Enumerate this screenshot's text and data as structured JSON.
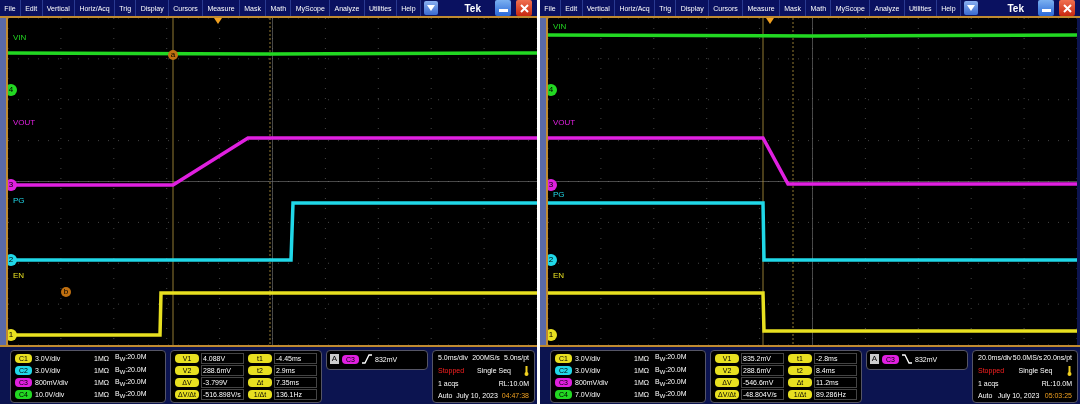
{
  "scopes": [
    {
      "menu": [
        "File",
        "Edit",
        "Vertical",
        "Horiz/Acq",
        "Trig",
        "Display",
        "Cursors",
        "Measure",
        "Mask",
        "Math",
        "MyScope",
        "Analyze",
        "Utilities",
        "Help"
      ],
      "brand": "Tek",
      "traces": [
        {
          "label": "VIN",
          "marker": "4",
          "color": "#22d822"
        },
        {
          "label": "VOUT",
          "marker": "3",
          "color": "#e020e0"
        },
        {
          "label": "PG",
          "marker": "2",
          "color": "#20d8e8"
        },
        {
          "label": "EN",
          "marker": "1",
          "color": "#e8e020"
        }
      ],
      "cursor_marks": [
        "a",
        "b"
      ],
      "channels": [
        {
          "chip": "C1",
          "scale": "3.0V/div",
          "impedance": "1MΩ",
          "bandwidth": "B$_{W}$:20.0M",
          "color": "#e8e020"
        },
        {
          "chip": "C2",
          "scale": "3.0V/div",
          "impedance": "1MΩ",
          "bandwidth": "B$_{W}$:20.0M",
          "color": "#20d8e8"
        },
        {
          "chip": "C3",
          "scale": "800mV/div",
          "impedance": "1MΩ",
          "bandwidth": "B$_{W}$:20.0M",
          "color": "#e020e0"
        },
        {
          "chip": "C4",
          "scale": "10.0V/div",
          "impedance": "1MΩ",
          "bandwidth": "B$_{W}$:20.0M",
          "color": "#22d822"
        }
      ],
      "cursors": [
        {
          "label": "V1",
          "value": "4.088V"
        },
        {
          "label": "t1",
          "value": "-4.45ms"
        },
        {
          "label": "V2",
          "value": "288.6mV"
        },
        {
          "label": "t2",
          "value": "2.9ms"
        },
        {
          "label": "ΔV",
          "value": "-3.799V"
        },
        {
          "label": "Δt",
          "value": "7.35ms"
        },
        {
          "label": "ΔV/Δt",
          "value": "-516.898V/s"
        },
        {
          "label": "1/Δt",
          "value": "136.1Hz"
        }
      ],
      "trigger": {
        "badge": "A",
        "channel": "C3",
        "color": "#e020e0",
        "kind": "rising",
        "level": "832mV"
      },
      "acquisition": {
        "timebase": "5.0ms/div",
        "sample_rate": "200MS/s",
        "resolution": "5.0ns/pt",
        "state": "Stopped",
        "mode": "Single Seq",
        "acqs": "1 acqs",
        "record_length": "RL:10.0M",
        "trigger_mode": "Auto",
        "date": "July 10, 2023",
        "time": "04:47:38"
      }
    },
    {
      "menu": [
        "File",
        "Edit",
        "Vertical",
        "Horiz/Acq",
        "Trig",
        "Display",
        "Cursors",
        "Measure",
        "Mask",
        "Math",
        "MyScope",
        "Analyze",
        "Utilities",
        "Help"
      ],
      "brand": "Tek",
      "traces": [
        {
          "label": "VIN",
          "marker": "4",
          "color": "#22d822"
        },
        {
          "label": "VOUT",
          "marker": "3",
          "color": "#e020e0"
        },
        {
          "label": "PG",
          "marker": "2",
          "color": "#20d8e8"
        },
        {
          "label": "EN",
          "marker": "1",
          "color": "#e8e020"
        }
      ],
      "channels": [
        {
          "chip": "C1",
          "scale": "3.0V/div",
          "impedance": "1MΩ",
          "bandwidth": "B$_{W}$:20.0M",
          "color": "#e8e020"
        },
        {
          "chip": "C2",
          "scale": "3.0V/div",
          "impedance": "1MΩ",
          "bandwidth": "B$_{W}$:20.0M",
          "color": "#20d8e8"
        },
        {
          "chip": "C3",
          "scale": "800mV/div",
          "impedance": "1MΩ",
          "bandwidth": "B$_{W}$:20.0M",
          "color": "#e020e0"
        },
        {
          "chip": "C4",
          "scale": "7.0V/div",
          "impedance": "1MΩ",
          "bandwidth": "B$_{W}$:20.0M",
          "color": "#22d822"
        }
      ],
      "cursors": [
        {
          "label": "V1",
          "value": "835.2mV"
        },
        {
          "label": "t1",
          "value": "-2.8ms"
        },
        {
          "label": "V2",
          "value": "288.6mV"
        },
        {
          "label": "t2",
          "value": "8.4ms"
        },
        {
          "label": "ΔV",
          "value": "-546.6mV"
        },
        {
          "label": "Δt",
          "value": "11.2ms"
        },
        {
          "label": "ΔV/Δt",
          "value": "-48.804V/s"
        },
        {
          "label": "1/Δt",
          "value": "89.286Hz"
        }
      ],
      "trigger": {
        "badge": "A",
        "channel": "C3",
        "color": "#e020e0",
        "kind": "falling",
        "level": "832mV"
      },
      "acquisition": {
        "timebase": "20.0ms/div",
        "sample_rate": "50.0MS/s",
        "resolution": "20.0ns/pt",
        "state": "Stopped",
        "mode": "Single Seq",
        "acqs": "1 acqs",
        "record_length": "RL:10.0M",
        "trigger_mode": "Auto",
        "date": "July 10, 2023",
        "time": "05:03:25"
      }
    }
  ]
}
